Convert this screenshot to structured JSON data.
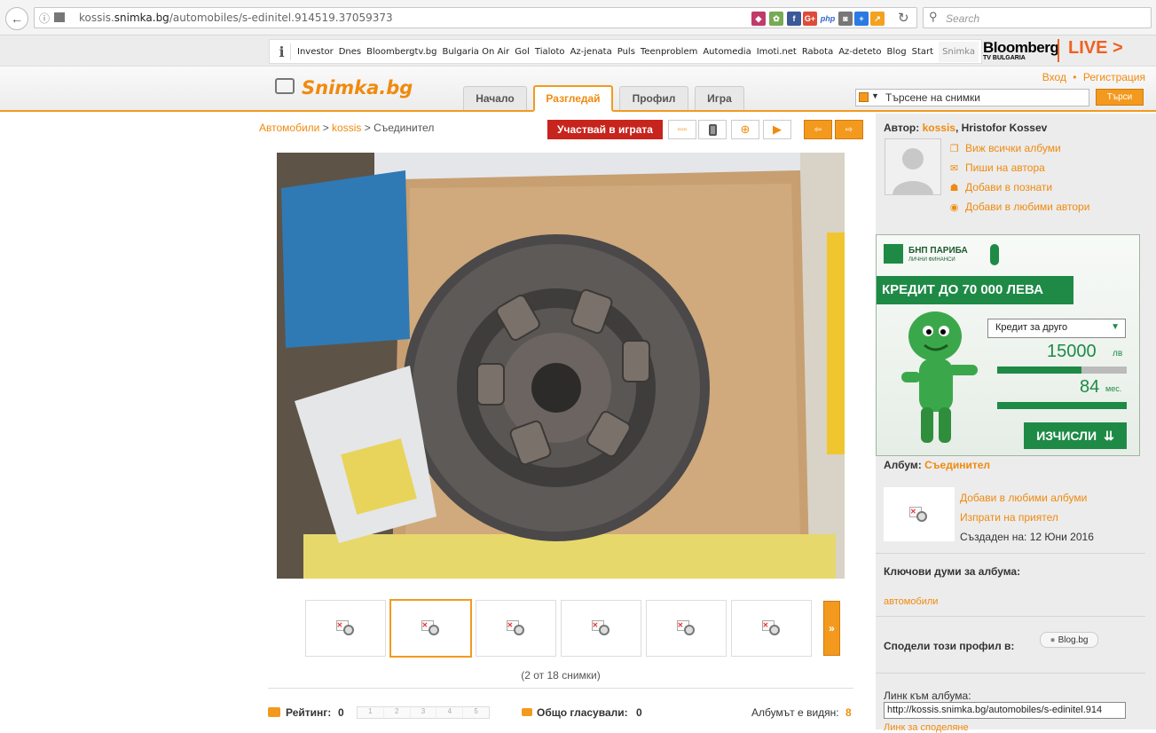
{
  "browser": {
    "url_prefix": "kossis.",
    "url_domain": "snimka.bg",
    "url_path": "/automobiles/s-edinitel.914519.37059373",
    "search_placeholder": "Search",
    "ext_gplus": "G+",
    "ext_php": "php"
  },
  "partners": {
    "items": [
      "Investor",
      "Dnes",
      "Bloombergtv.bg",
      "Bulgaria On Air",
      "Gol",
      "Tialoto",
      "Az-jenata",
      "Puls",
      "Teenproblem",
      "Automedia",
      "Imoti.net",
      "Rabota",
      "Az-deteto",
      "Blog",
      "Start",
      "Snimka"
    ],
    "bloomberg": "Bloomberg",
    "bloomberg_sub": "TV BULGARIA",
    "live": "LIVE >"
  },
  "header": {
    "logo": "Snimka.bg",
    "tabs": [
      "Начало",
      "Разгледай",
      "Профил",
      "Игра"
    ],
    "login": "Вход",
    "register": "Регистрация",
    "search_placeholder": "Търсене на снимки",
    "search_button": "Търси"
  },
  "main": {
    "breadcrumb": [
      "Автомобили",
      "kossis",
      "Съединител"
    ],
    "play_button": "Участвай в играта",
    "counter": "(2 от 18 снимки)",
    "rating_label": "Рейтинг:",
    "rating_value": "0",
    "rating_ticks": [
      "1",
      "2",
      "3",
      "4",
      "5"
    ],
    "votes_label": "Общо гласували:",
    "votes_value": "0",
    "views_label": "Албумът е видян:",
    "views_value": "8",
    "more_thumbs": "»"
  },
  "sidebar": {
    "author_label": "Автор:",
    "author_user": "kossis",
    "author_name": ", Hristofor Kossev",
    "actions": [
      "Виж всички албуми",
      "Пиши на автора",
      "Добави в познати",
      "Добави в любими автори"
    ],
    "album_label": "Албум:",
    "album_name": "Съединител",
    "album_actions": [
      "Добави в любими албуми",
      "Изпрати на приятел"
    ],
    "created_label": "Създаден на:",
    "created_date": "12 Юни 2016",
    "keywords_label": "Ключови думи за албума:",
    "keyword": "автомобили",
    "share_label": "Сподели този профил в:",
    "share_blog": "Blog.bg",
    "link_label": "Линк към албума:",
    "link_value": "http://kossis.snimka.bg/automobiles/s-edinitel.914",
    "link_cut": "Линк за споделяне"
  },
  "ad": {
    "brand": "БНП ПАРИБА",
    "brand_sub": "ЛИЧНИ ФИНАНСИ",
    "headline": "КРЕДИТ ДО 70 000 ЛЕВА",
    "select": "Кредит за друго",
    "amount": "15000",
    "amount_unit": "лв",
    "months": "84",
    "months_unit": "мес.",
    "cta": "ИЗЧИСЛИ",
    "amount_fill": 0.65,
    "months_fill": 1.0
  },
  "colors": {
    "accent": "#f08a0e",
    "play": "#c6241d",
    "ad_green": "#1e8a46"
  }
}
